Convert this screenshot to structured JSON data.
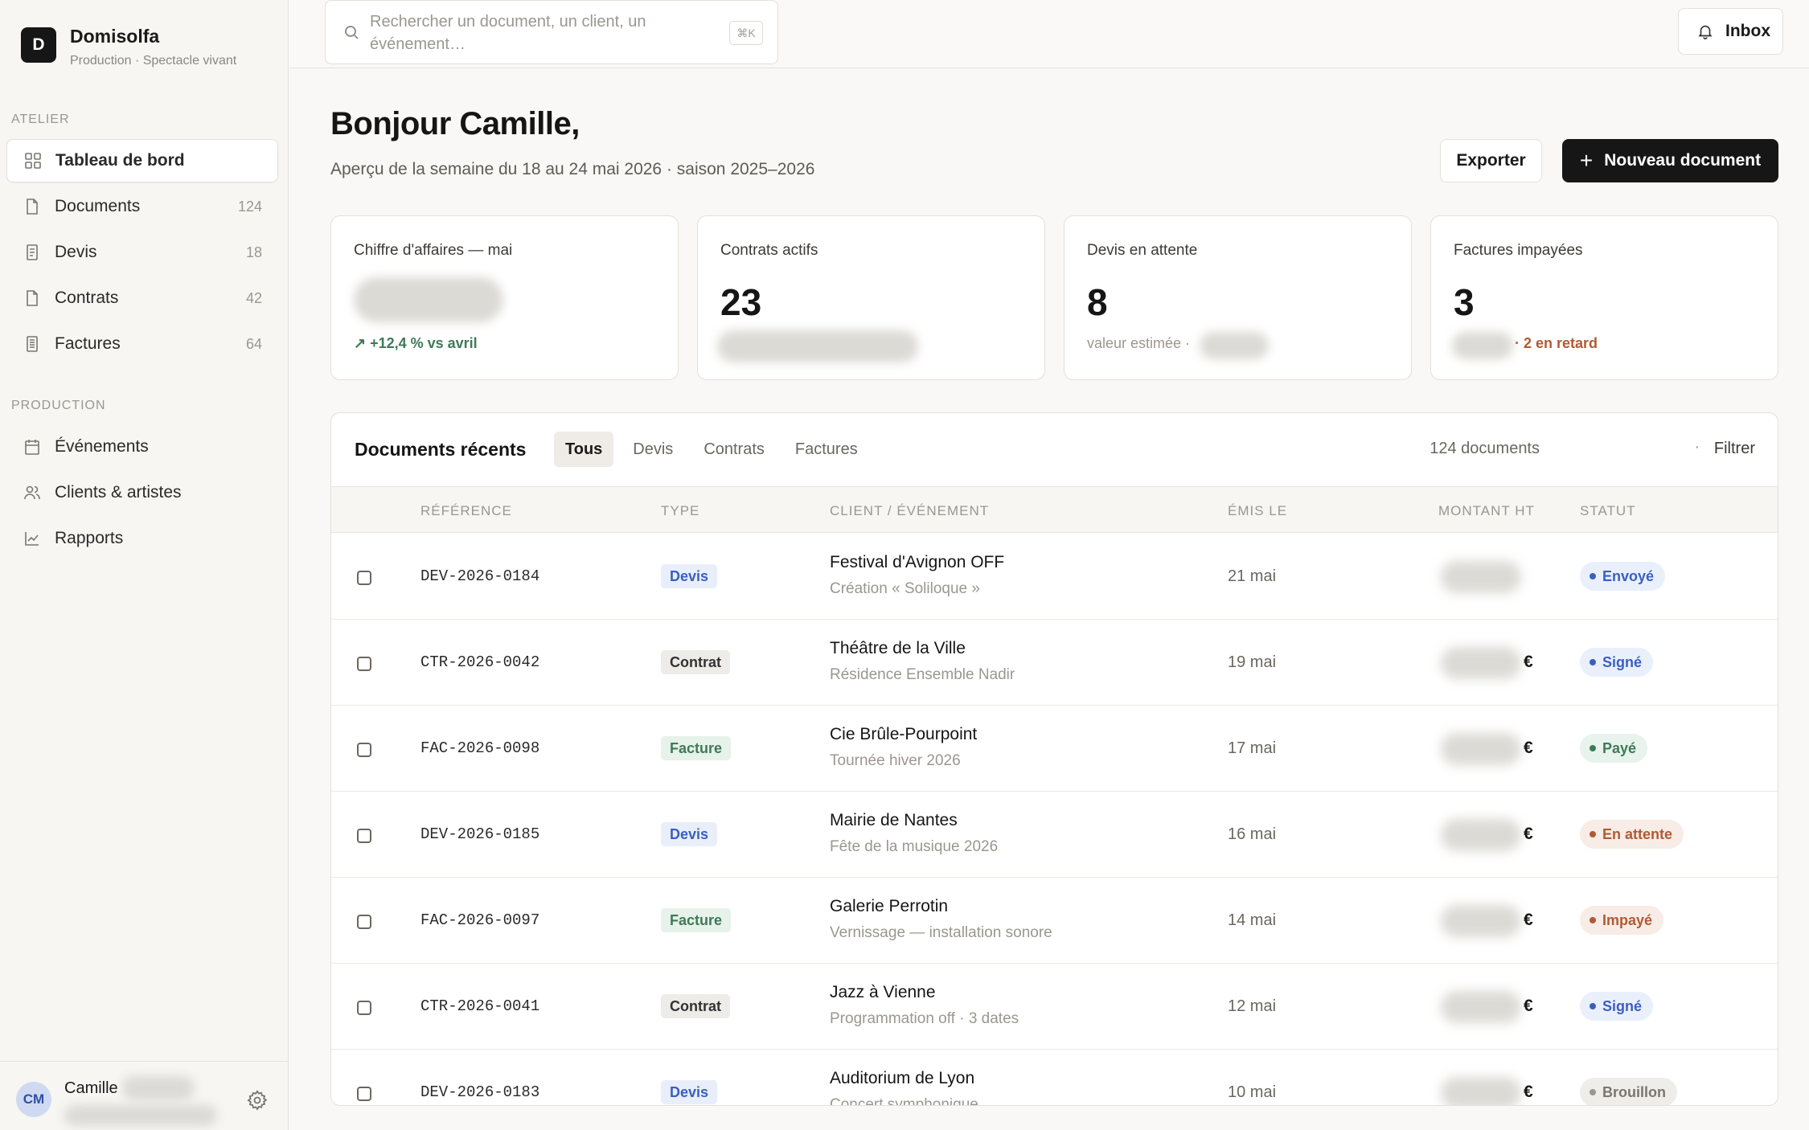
{
  "brand": {
    "logo_letter": "D",
    "name": "Domisolfa",
    "subtitle": "Production · Spectacle vivant"
  },
  "sidebar": {
    "sections": [
      {
        "label": "ATELIER"
      },
      {
        "label": "PRODUCTION"
      }
    ],
    "items": [
      {
        "label": "Tableau de bord",
        "icon": "grid-icon",
        "count": "",
        "active": true
      },
      {
        "label": "Documents",
        "icon": "document-icon",
        "count": "124"
      },
      {
        "label": "Devis",
        "icon": "receipt-icon",
        "count": "18"
      },
      {
        "label": "Contrats",
        "icon": "document-icon",
        "count": "42"
      },
      {
        "label": "Factures",
        "icon": "invoice-icon",
        "count": "64"
      },
      {
        "label": "Événements",
        "icon": "calendar-icon",
        "count": ""
      },
      {
        "label": "Clients & artistes",
        "icon": "users-icon",
        "count": ""
      },
      {
        "label": "Rapports",
        "icon": "chart-icon",
        "count": ""
      }
    ]
  },
  "user": {
    "initials": "CM",
    "name": "Camille"
  },
  "topbar": {
    "search_placeholder": "Rechercher un document, un client, un événement…",
    "shortcut": "⌘K",
    "inbox_label": "Inbox"
  },
  "header": {
    "greeting": "Bonjour Camille,",
    "subtitle": "Aperçu de la semaine du 18 au 24 mai 2026 · saison 2025–2026",
    "export_label": "Exporter",
    "new_label": "Nouveau document"
  },
  "stats": [
    {
      "label": "Chiffre d'affaires — mai",
      "value": "",
      "foot": "↗ +12,4 % vs avril",
      "foot_color": "#3f7a57"
    },
    {
      "label": "Contrats actifs",
      "value": "23",
      "foot": ""
    },
    {
      "label": "Devis en attente",
      "value": "8",
      "foot": "valeur estimée ·"
    },
    {
      "label": "Factures impayées",
      "value": "3",
      "foot": "· 2 en retard",
      "foot_color": "#b05a35"
    }
  ],
  "documents": {
    "title": "Documents récents",
    "tabs": [
      "Tous",
      "Devis",
      "Contrats",
      "Factures"
    ],
    "active_tab": "Tous",
    "count_label": "124 documents",
    "separator": "·",
    "filter_label": "Filtrer",
    "columns": [
      "RÉFÉRENCE",
      "TYPE",
      "CLIENT / ÉVÉNEMENT",
      "ÉMIS LE",
      "MONTANT HT",
      "STATUT"
    ],
    "rows": [
      {
        "ref": "DEV-2026-0184",
        "type": "Devis",
        "type_key": "devis",
        "client": "Festival d'Avignon OFF",
        "event": "Création « Soliloque »",
        "date": "21 mai",
        "currency": "",
        "status": "Envoyé",
        "status_key": "envoye"
      },
      {
        "ref": "CTR-2026-0042",
        "type": "Contrat",
        "type_key": "contrat",
        "client": "Théâtre de la Ville",
        "event": "Résidence Ensemble Nadir",
        "date": "19 mai",
        "currency": "€",
        "status": "Signé",
        "status_key": "signe"
      },
      {
        "ref": "FAC-2026-0098",
        "type": "Facture",
        "type_key": "facture",
        "client": "Cie Brûle-Pourpoint",
        "event": "Tournée hiver 2026",
        "date": "17 mai",
        "currency": "€",
        "status": "Payé",
        "status_key": "paye"
      },
      {
        "ref": "DEV-2026-0185",
        "type": "Devis",
        "type_key": "devis",
        "client": "Mairie de Nantes",
        "event": "Fête de la musique 2026",
        "date": "16 mai",
        "currency": "€",
        "status": "En attente",
        "status_key": "attente"
      },
      {
        "ref": "FAC-2026-0097",
        "type": "Facture",
        "type_key": "facture",
        "client": "Galerie Perrotin",
        "event": "Vernissage — installation sonore",
        "date": "14 mai",
        "currency": "€",
        "status": "Impayé",
        "status_key": "impaye"
      },
      {
        "ref": "CTR-2026-0041",
        "type": "Contrat",
        "type_key": "contrat",
        "client": "Jazz à Vienne",
        "event": "Programmation off · 3 dates",
        "date": "12 mai",
        "currency": "€",
        "status": "Signé",
        "status_key": "signe"
      },
      {
        "ref": "DEV-2026-0183",
        "type": "Devis",
        "type_key": "devis",
        "client": "Auditorium de Lyon",
        "event": "Concert symphonique",
        "date": "10 mai",
        "currency": "€",
        "status": "Brouillon",
        "status_key": "brouillon"
      }
    ]
  }
}
